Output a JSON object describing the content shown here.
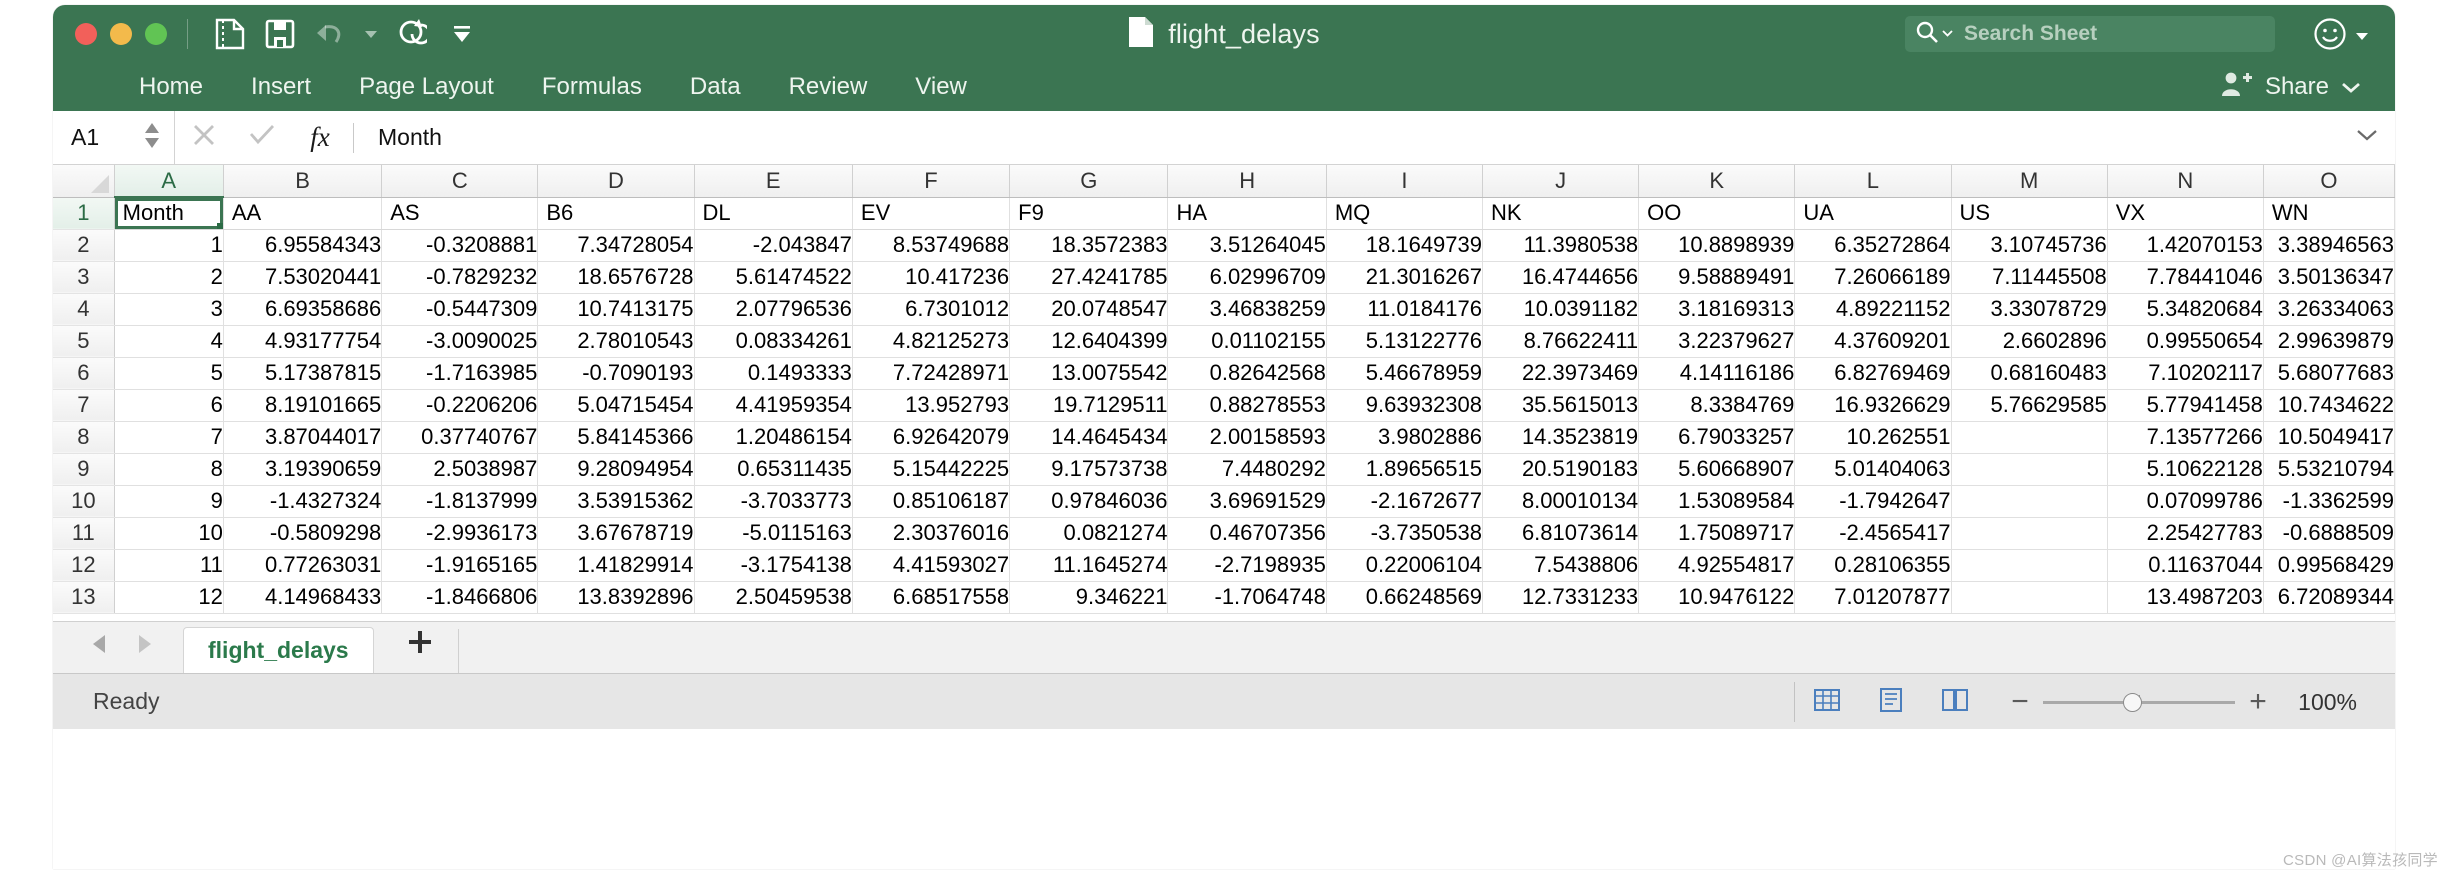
{
  "titlebar": {
    "document_name": "flight_delays",
    "document_icon": "document-icon",
    "traffic_lights": [
      {
        "name": "close-window-button",
        "color": "#f2605a"
      },
      {
        "name": "minimize-window-button",
        "color": "#f3ba4b"
      },
      {
        "name": "maximize-window-button",
        "color": "#61c454"
      }
    ],
    "quick_access": [
      {
        "name": "new-from-template-button",
        "icon": "page-icon"
      },
      {
        "name": "save-button",
        "icon": "floppy-disk-icon"
      },
      {
        "name": "undo-button",
        "icon": "undo-arrow-icon"
      },
      {
        "name": "undo-dropdown-button",
        "icon": "caret-down-icon"
      },
      {
        "name": "redo-button",
        "icon": "redo-arrow-icon"
      },
      {
        "name": "customize-toolbar-button",
        "icon": "overflow-caret-icon"
      }
    ],
    "search": {
      "placeholder": "Search Sheet",
      "icon": "search-icon",
      "dropdown_icon": "chevron-down-icon"
    },
    "account": {
      "icon": "smiley-face-icon",
      "dropdown_icon": "caret-down-icon"
    },
    "accent_color": "#3b7552"
  },
  "ribbon": {
    "tabs": [
      {
        "label": "Home",
        "active": false
      },
      {
        "label": "Insert",
        "active": false
      },
      {
        "label": "Page Layout",
        "active": false
      },
      {
        "label": "Formulas",
        "active": false
      },
      {
        "label": "Data",
        "active": false
      },
      {
        "label": "Review",
        "active": false
      },
      {
        "label": "View",
        "active": false
      }
    ],
    "share": {
      "label": "Share",
      "icon": "person-plus-icon",
      "dropdown_icon": "chevron-down-icon"
    }
  },
  "formula_bar": {
    "name_box_value": "A1",
    "name_box_spinner": "spinner-updown-icon",
    "cancel_icon": "cancel-x-icon",
    "confirm_icon": "confirm-check-icon",
    "function_icon": "fx-icon",
    "formula_value": "Month",
    "collapse_icon": "chevron-down-icon"
  },
  "grid": {
    "columns": [
      "A",
      "B",
      "C",
      "D",
      "E",
      "F",
      "G",
      "H",
      "I",
      "J",
      "K",
      "L",
      "M",
      "N",
      "O"
    ],
    "selected_cell": "A1",
    "row_numbers": [
      1,
      2,
      3,
      4,
      5,
      6,
      7,
      8,
      9,
      10,
      11,
      12,
      13
    ],
    "header_row": [
      "Month",
      "AA",
      "AS",
      "B6",
      "DL",
      "EV",
      "F9",
      "HA",
      "MQ",
      "NK",
      "OO",
      "UA",
      "US",
      "VX",
      "WN"
    ],
    "rows": [
      [
        "1",
        "6.95584343",
        "-0.3208881",
        "7.34728054",
        "-2.043847",
        "8.53749688",
        "18.3572383",
        "3.51264045",
        "18.1649739",
        "11.3980538",
        "10.8898939",
        "6.35272864",
        "3.10745736",
        "1.42070153",
        "3.38946563"
      ],
      [
        "2",
        "7.53020441",
        "-0.7829232",
        "18.6576728",
        "5.61474522",
        "10.417236",
        "27.4241785",
        "6.02996709",
        "21.3016267",
        "16.4744656",
        "9.58889491",
        "7.26066189",
        "7.11445508",
        "7.78441046",
        "3.50136347"
      ],
      [
        "3",
        "6.69358686",
        "-0.5447309",
        "10.7413175",
        "2.07796536",
        "6.7301012",
        "20.0748547",
        "3.46838259",
        "11.0184176",
        "10.0391182",
        "3.18169313",
        "4.89221152",
        "3.33078729",
        "5.34820684",
        "3.26334063"
      ],
      [
        "4",
        "4.93177754",
        "-3.0090025",
        "2.78010543",
        "0.08334261",
        "4.82125273",
        "12.6404399",
        "0.01102155",
        "5.13122776",
        "8.76622411",
        "3.22379627",
        "4.37609201",
        "2.6602896",
        "0.99550654",
        "2.99639879"
      ],
      [
        "5",
        "5.17387815",
        "-1.7163985",
        "-0.7090193",
        "0.1493333",
        "7.72428971",
        "13.0075542",
        "0.82642568",
        "5.46678959",
        "22.3973469",
        "4.14116186",
        "6.82769469",
        "0.68160483",
        "7.10202117",
        "5.68077683"
      ],
      [
        "6",
        "8.19101665",
        "-0.2206206",
        "5.04715454",
        "4.41959354",
        "13.952793",
        "19.7129511",
        "0.88278553",
        "9.63932308",
        "35.5615013",
        "8.3384769",
        "16.9326629",
        "5.76629585",
        "5.77941458",
        "10.7434622"
      ],
      [
        "7",
        "3.87044017",
        "0.37740767",
        "5.84145366",
        "1.20486154",
        "6.92642079",
        "14.4645434",
        "2.00158593",
        "3.9802886",
        "14.3523819",
        "6.79033257",
        "10.262551",
        "",
        "7.13577266",
        "10.5049417"
      ],
      [
        "8",
        "3.19390659",
        "2.5038987",
        "9.28094954",
        "0.65311435",
        "5.15442225",
        "9.17573738",
        "7.4480292",
        "1.89656515",
        "20.5190183",
        "5.60668907",
        "5.01404063",
        "",
        "5.10622128",
        "5.53210794"
      ],
      [
        "9",
        "-1.4327324",
        "-1.8137999",
        "3.53915362",
        "-3.7033773",
        "0.85106187",
        "0.97846036",
        "3.69691529",
        "-2.1672677",
        "8.00010134",
        "1.53089584",
        "-1.7942647",
        "",
        "0.07099786",
        "-1.3362599"
      ],
      [
        "10",
        "-0.5809298",
        "-2.9936173",
        "3.67678719",
        "-5.0115163",
        "2.30376016",
        "0.0821274",
        "0.46707356",
        "-3.7350538",
        "6.81073614",
        "1.75089717",
        "-2.4565417",
        "",
        "2.25427783",
        "-0.6888509"
      ],
      [
        "11",
        "0.77263031",
        "-1.9165165",
        "1.41829914",
        "-3.1754138",
        "4.41593027",
        "11.1645274",
        "-2.7198935",
        "0.22006104",
        "7.5438806",
        "4.92554817",
        "0.28106355",
        "",
        "0.11637044",
        "0.99568429"
      ],
      [
        "12",
        "4.14968433",
        "-1.8466806",
        "13.8392896",
        "2.50459538",
        "6.68517558",
        "9.346221",
        "-1.7064748",
        "0.66248569",
        "12.7331233",
        "10.9476122",
        "7.01207877",
        "",
        "13.4987203",
        "6.72089344"
      ]
    ]
  },
  "sheet_bar": {
    "prev_icon": "left-triangle-icon",
    "next_icon": "right-triangle-icon",
    "tabs": [
      {
        "label": "flight_delays",
        "active": true
      }
    ],
    "add_icon": "plus-icon"
  },
  "status_bar": {
    "status": "Ready",
    "view_buttons": [
      {
        "name": "normal-view-button",
        "icon": "grid-view-icon"
      },
      {
        "name": "page-layout-view-button",
        "icon": "page-layout-icon"
      },
      {
        "name": "page-break-view-button",
        "icon": "page-break-icon"
      }
    ],
    "zoom": {
      "minus": "−",
      "plus": "+",
      "level": "100%"
    }
  },
  "watermark": "CSDN @AI算法孩同学"
}
